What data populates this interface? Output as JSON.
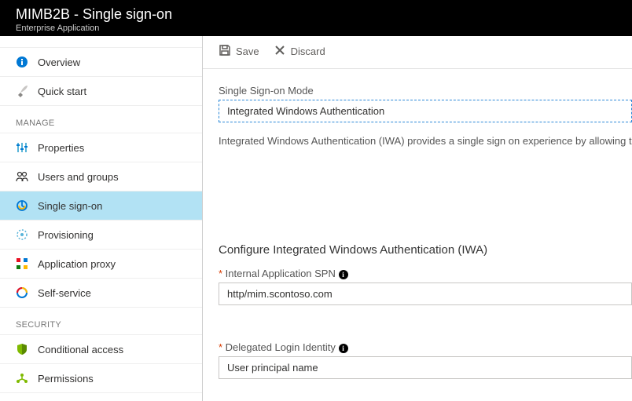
{
  "header": {
    "title": "MIMB2B - Single sign-on",
    "subtitle": "Enterprise Application"
  },
  "toolbar": {
    "save_label": "Save",
    "discard_label": "Discard"
  },
  "sidebar": {
    "top": [
      {
        "label": "Overview"
      },
      {
        "label": "Quick start"
      }
    ],
    "manage_heading": "MANAGE",
    "manage": [
      {
        "label": "Properties"
      },
      {
        "label": "Users and groups"
      },
      {
        "label": "Single sign-on"
      },
      {
        "label": "Provisioning"
      },
      {
        "label": "Application proxy"
      },
      {
        "label": "Self-service"
      }
    ],
    "security_heading": "SECURITY",
    "security": [
      {
        "label": "Conditional access"
      },
      {
        "label": "Permissions"
      }
    ]
  },
  "main": {
    "mode_label": "Single Sign-on Mode",
    "mode_value": "Integrated Windows Authentication",
    "mode_description": "Integrated Windows Authentication (IWA) provides a single sign on experience by allowing the Ap",
    "config_heading": "Configure Integrated Windows Authentication (IWA)",
    "spn_label": "Internal Application SPN",
    "spn_value": "http/mim.scontoso.com",
    "identity_label": "Delegated Login Identity",
    "identity_value": "User principal name"
  }
}
